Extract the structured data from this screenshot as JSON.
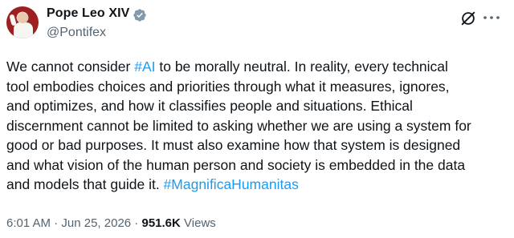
{
  "author": {
    "display_name": "Pope Leo XIV",
    "handle": "@Pontifex",
    "verified_color": "#829aab"
  },
  "icons": {
    "verified": "verified-badge-icon",
    "grok": "grok-icon",
    "more": "more-options-icon"
  },
  "tweet": {
    "lines": [
      {
        "pre": "We cannot consider ",
        "tag": "#AI",
        "post": " to be morally neutral. In reality, every technical"
      },
      {
        "pre": "tool embodies choices and priorities through what it measures, ignores,"
      },
      {
        "pre": "and optimizes, and how it classifies people and situations. Ethical"
      },
      {
        "pre": "discernment cannot be limited to asking whether we are using a system for"
      },
      {
        "pre": "good or bad purposes. It must also examine how that system is designed"
      },
      {
        "pre": "and what vision of the human person and society is embedded in the data"
      },
      {
        "pre": "and models that guide it. ",
        "tag": "#MagnificaHumanitas"
      }
    ],
    "link_color": "#1d9bf0"
  },
  "meta": {
    "time": "6:01 AM",
    "separator": " · ",
    "date": "Jun 25, 2026",
    "views_count": "951.6K",
    "views_label": "Views"
  }
}
